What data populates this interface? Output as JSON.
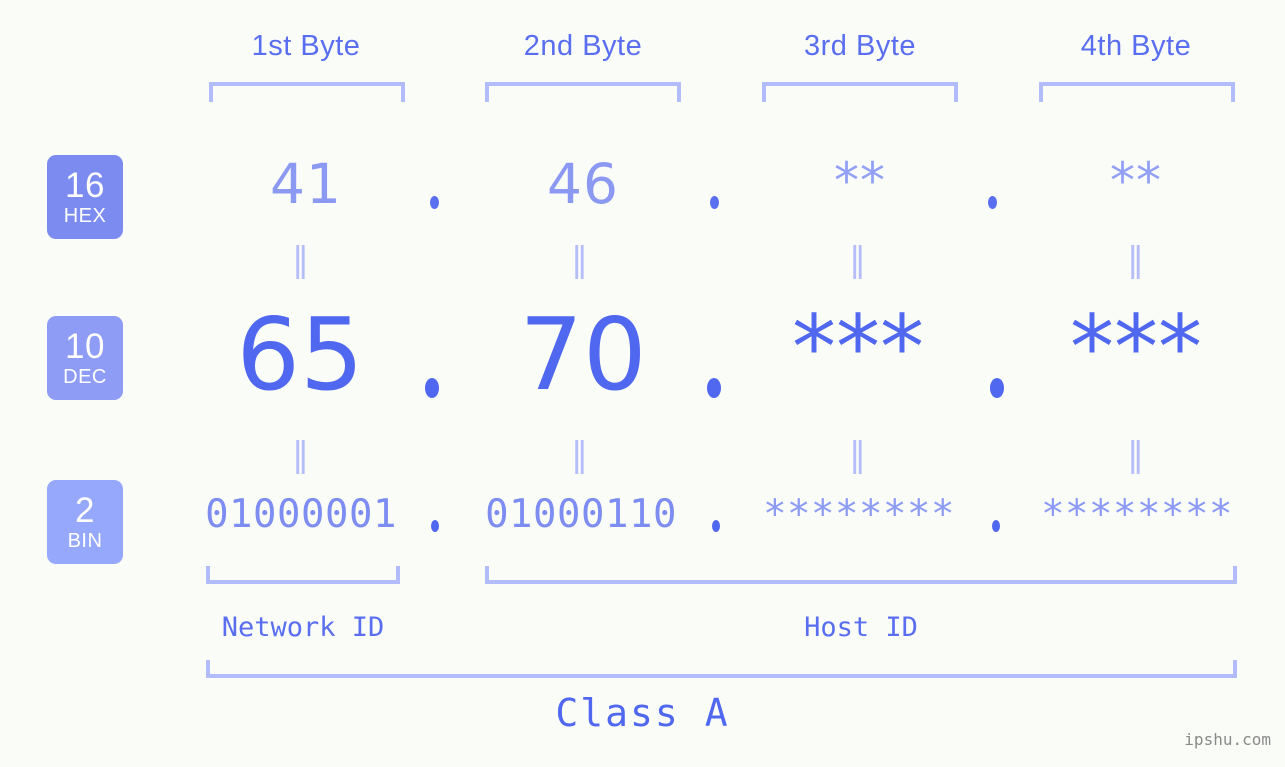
{
  "background": "#fafcf8",
  "accent": "#5067ef",
  "accent_light": "#b3bcfb",
  "watermark": "ipshu.com",
  "byte_headers": [
    {
      "label": "1st Byte"
    },
    {
      "label": "2nd Byte"
    },
    {
      "label": "3rd Byte"
    },
    {
      "label": "4th Byte"
    }
  ],
  "bases": [
    {
      "number": "16",
      "name": "HEX",
      "color": "#7b8bf0"
    },
    {
      "number": "10",
      "name": "DEC",
      "color": "#8e9cf5"
    },
    {
      "number": "2",
      "name": "BIN",
      "color": "#96a8fb"
    }
  ],
  "rows": {
    "hex": {
      "values": [
        "41",
        "46",
        "**",
        "**"
      ],
      "separator": "."
    },
    "dec": {
      "values": [
        "65",
        "70",
        "***",
        "***"
      ],
      "separator": "."
    },
    "bin": {
      "values": [
        "01000001",
        "01000110",
        "********",
        "********"
      ],
      "separator": "."
    }
  },
  "equals_mark": "‖",
  "sections": {
    "network_id": "Network ID",
    "host_id": "Host ID",
    "class": "Class A"
  }
}
